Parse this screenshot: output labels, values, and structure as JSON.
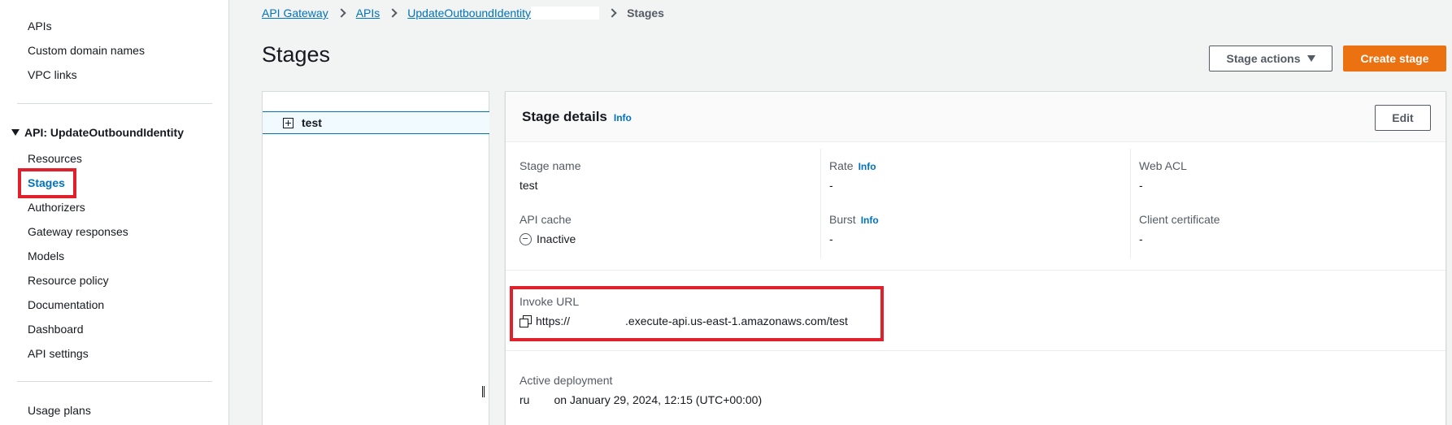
{
  "sidebar": {
    "top_items": [
      {
        "label": "APIs"
      },
      {
        "label": "Custom domain names"
      },
      {
        "label": "VPC links"
      }
    ],
    "section_title": "API: UpdateOutboundIdentity",
    "api_items": [
      {
        "label": "Resources"
      },
      {
        "label": "Stages"
      },
      {
        "label": "Authorizers"
      },
      {
        "label": "Gateway responses"
      },
      {
        "label": "Models"
      },
      {
        "label": "Resource policy"
      },
      {
        "label": "Documentation"
      },
      {
        "label": "Dashboard"
      },
      {
        "label": "API settings"
      }
    ],
    "bottom_items": [
      {
        "label": "Usage plans"
      }
    ]
  },
  "breadcrumb": {
    "items": [
      "API Gateway",
      "APIs",
      "UpdateOutboundIdentity"
    ],
    "current": "Stages"
  },
  "page": {
    "title": "Stages",
    "stage_actions_label": "Stage actions",
    "create_stage_label": "Create stage"
  },
  "tree": {
    "stages": [
      {
        "label": "test"
      }
    ]
  },
  "details": {
    "title": "Stage details",
    "info_label": "Info",
    "edit_label": "Edit",
    "stage_name_label": "Stage name",
    "stage_name_value": "test",
    "rate_label": "Rate",
    "rate_value": "-",
    "web_acl_label": "Web ACL",
    "web_acl_value": "-",
    "api_cache_label": "API cache",
    "api_cache_value": "Inactive",
    "burst_label": "Burst",
    "burst_value": "-",
    "client_cert_label": "Client certificate",
    "client_cert_value": "-",
    "invoke_url_label": "Invoke URL",
    "invoke_url_prefix": "https://",
    "invoke_url_suffix": ".execute-api.us-east-1.amazonaws.com/test",
    "active_deployment_label": "Active deployment",
    "active_deployment_prefix": "ru",
    "active_deployment_suffix": "on January 29, 2024, 12:15 (UTC+00:00)"
  },
  "colors": {
    "link": "#0073bb",
    "primary_button": "#ec7211",
    "highlight": "#e0202a"
  }
}
